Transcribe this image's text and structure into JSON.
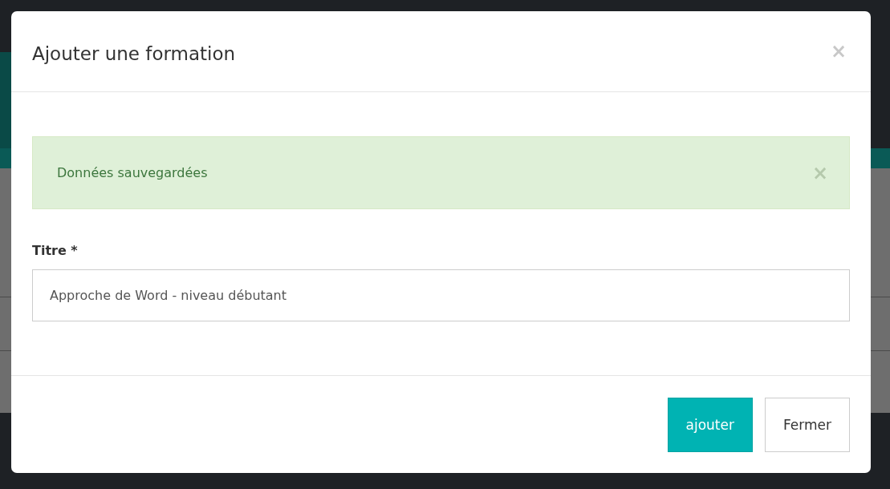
{
  "dialog": {
    "title": "Ajouter une formation",
    "close": "×"
  },
  "alert": {
    "kind": "success",
    "message": "Données sauvegardées",
    "dismiss": "×"
  },
  "field": {
    "label": "Titre *",
    "value": "Approche de Word - niveau débutant"
  },
  "buttons": [
    {
      "label": "ajouter",
      "kind": "primary"
    },
    {
      "label": "Fermer",
      "kind": "default"
    }
  ]
}
